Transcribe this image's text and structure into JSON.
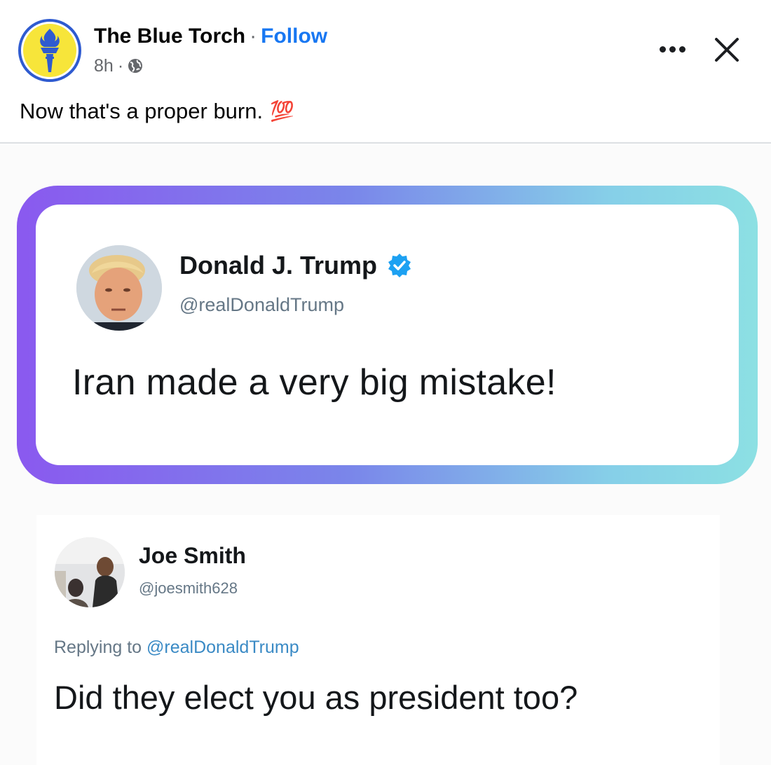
{
  "post": {
    "page_name": "The Blue Torch",
    "separator": "·",
    "follow_label": "Follow",
    "time": "8h",
    "meta_separator": "·",
    "audience_icon": "globe-icon",
    "caption": "Now that's a proper burn.",
    "caption_emoji": "💯",
    "avatar_icon": "torch-icon"
  },
  "controls": {
    "more_icon": "more-options-icon",
    "close_icon": "close-icon"
  },
  "image": {
    "tweet": {
      "name": "Donald J. Trump",
      "verified_icon": "verified-badge-icon",
      "handle": "@realDonaldTrump",
      "text": "Iran made a very big mistake!"
    },
    "reply": {
      "name": "Joe Smith",
      "handle": "@joesmith628",
      "replying_prefix": "Replying to",
      "replying_handle": "@realDonaldTrump",
      "text": "Did they elect you as president too?"
    }
  },
  "colors": {
    "follow": "#1877f2",
    "avatar_ring": "#2f5bd0",
    "avatar_bg": "#f7e53a",
    "frame_gradient_start": "#8a59ef",
    "frame_gradient_end": "#8ce0e3",
    "verified": "#1da1f2"
  }
}
